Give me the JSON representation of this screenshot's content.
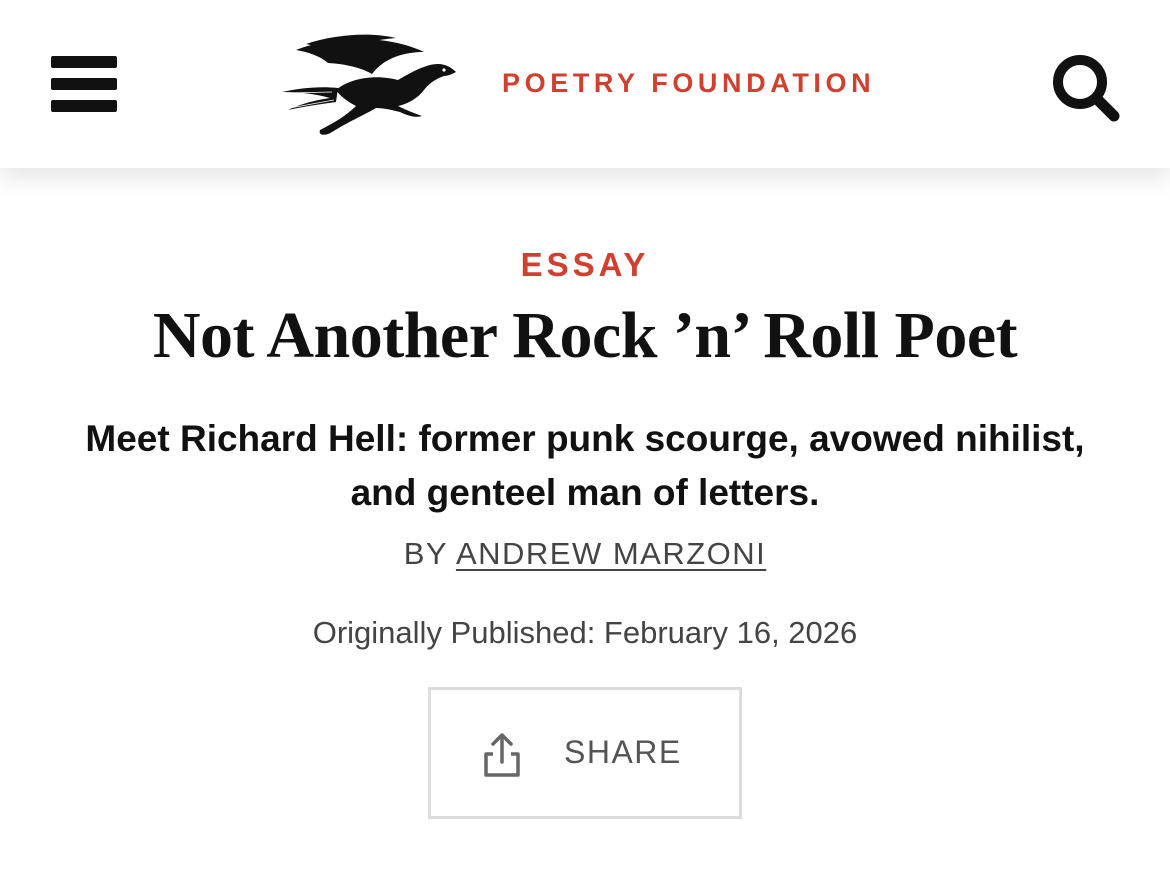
{
  "header": {
    "brand": "POETRY FOUNDATION",
    "menu_icon": "hamburger-menu-icon",
    "search_icon": "search-icon",
    "logo_icon": "pegasus-logo-icon"
  },
  "article": {
    "category": "ESSAY",
    "title": "Not Another Rock ’n’ Roll Poet",
    "subtitle": "Meet Richard Hell: former punk scourge, avowed nihilist, and genteel man of letters.",
    "byline_prefix": "BY",
    "author": "ANDREW MARZONI",
    "published": "Originally Published: February 16, 2026"
  },
  "share": {
    "label": "SHARE",
    "icon": "share-icon"
  },
  "colors": {
    "accent": "#d0402f",
    "text": "#111111",
    "muted": "#444444",
    "border": "#dcdcdc"
  }
}
